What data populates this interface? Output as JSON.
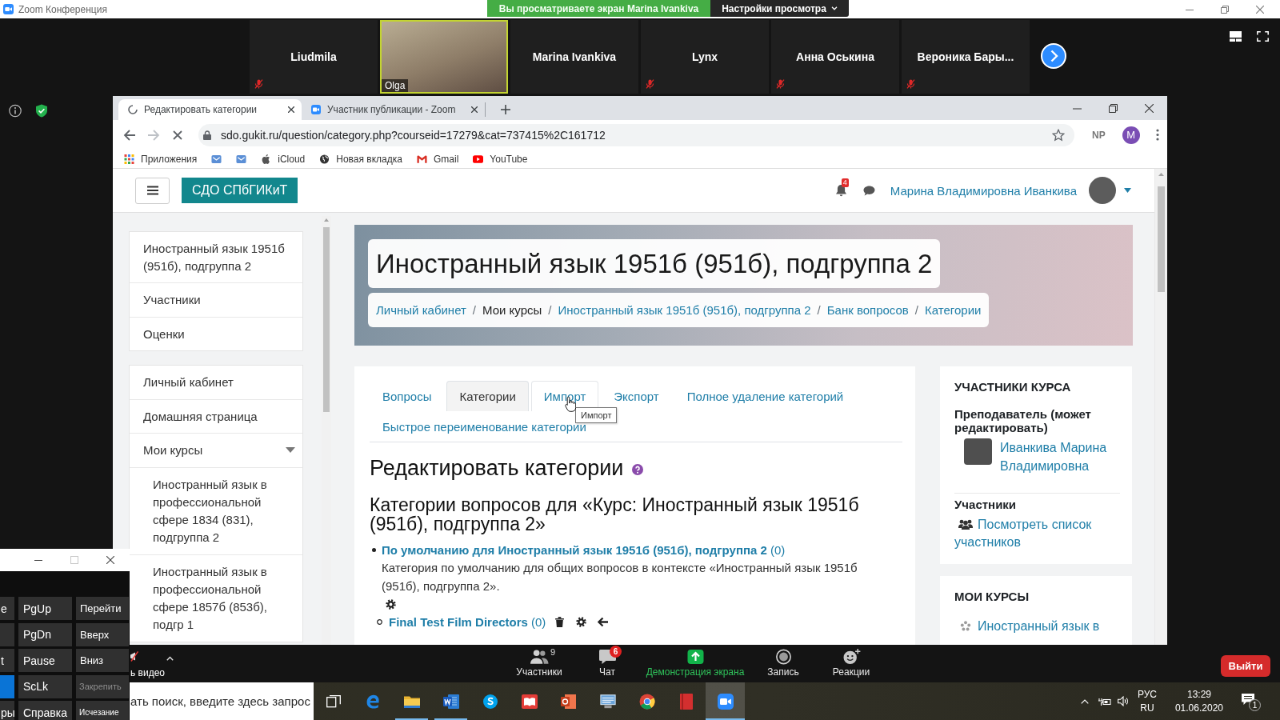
{
  "zoom_window": {
    "title": "Zoom Конференция",
    "share_banner": "Вы просматриваете экран Marina Ivankiva",
    "view_options": "Настройки просмотра"
  },
  "participants": [
    {
      "name": "Liudmila",
      "kind": "name",
      "muted": true,
      "speaking": false
    },
    {
      "name": "Olga",
      "kind": "video",
      "muted": false,
      "speaking": true
    },
    {
      "name": "Marina Ivankiva",
      "kind": "name",
      "muted": false,
      "speaking": false
    },
    {
      "name": "Lynx",
      "kind": "name",
      "muted": true,
      "speaking": false
    },
    {
      "name": "Анна Оськина",
      "kind": "name",
      "muted": true,
      "speaking": false
    },
    {
      "name": "Вероника Бары...",
      "kind": "name",
      "muted": true,
      "speaking": false
    }
  ],
  "browser": {
    "tabs": [
      {
        "title": "Редактировать категории",
        "selected": true,
        "loading": true
      },
      {
        "title": "Участник публикации - Zoom",
        "selected": false,
        "loading": false
      }
    ],
    "url": "sdo.gukit.ru/question/category.php?courseid=17279&cat=737415%2C161712",
    "extension": "NP",
    "profile": "M",
    "bookmarks": [
      {
        "kind": "apps",
        "label": "Приложения"
      },
      {
        "kind": "envelope"
      },
      {
        "kind": "envelope"
      },
      {
        "kind": "apple",
        "label": "iCloud"
      },
      {
        "kind": "globe",
        "label": "Новая вкладка"
      },
      {
        "kind": "mail-logo",
        "label": "Gmail"
      },
      {
        "kind": "play",
        "label": "YouTube"
      }
    ]
  },
  "site": {
    "brand": "СДО СПбГИКиТ",
    "notification_count": "4",
    "user_name": "Марина Владимировна Иванкива"
  },
  "drawer": {
    "groups": [
      {
        "items": [
          {
            "label": "Иностранный язык 1951б (951б), подгруппа 2",
            "kind": "link"
          },
          {
            "label": "Участники",
            "kind": "link"
          },
          {
            "label": "Оценки",
            "kind": "link"
          }
        ]
      },
      {
        "items": [
          {
            "label": "Личный кабинет",
            "kind": "link"
          },
          {
            "label": "Домашняя страница",
            "kind": "link"
          },
          {
            "label": "Мои курсы",
            "kind": "branch",
            "expanded": true,
            "children": [
              {
                "label": "Иностранный язык в профессиональной сфере 1834 (831), подгруппа 2",
                "kind": "link"
              },
              {
                "label": "Иностранный язык в профессиональной сфере 1857б (853б), подгр 1",
                "kind": "link"
              }
            ]
          }
        ]
      }
    ]
  },
  "page_header": {
    "title": "Иностранный язык 1951б (951б), подгруппа 2",
    "breadcrumb": [
      {
        "label": "Личный кабинет",
        "link": true
      },
      {
        "separator": "/",
        "label": "Мои курсы",
        "link": false
      },
      {
        "separator": "/",
        "label": "Иностранный язык 1951б (951б), подгруппа 2",
        "link": true
      },
      {
        "separator": "/",
        "label": "Банк вопросов",
        "link": true
      },
      {
        "separator": "/",
        "label": "Категории",
        "link": true
      }
    ]
  },
  "tabs": [
    {
      "label": "Вопросы",
      "selected": false,
      "hovered": false
    },
    {
      "label": "Категории",
      "selected": true,
      "hovered": false
    },
    {
      "label": "Импорт",
      "selected": false,
      "hovered": true
    },
    {
      "label": "Экспорт",
      "selected": false,
      "hovered": false
    },
    {
      "label": "Полное удаление категорий",
      "selected": false,
      "hovered": false
    },
    {
      "label": "Быстрое переименование категории",
      "selected": false,
      "hovered": false
    }
  ],
  "tooltip": "Импорт",
  "heading": "Редактировать категории",
  "context_heading": "Категории вопросов для «Курс: Иностранный язык 1951б (951б), подгруппа 2»",
  "categories": [
    {
      "name": "По умолчанию для Иностранный язык 1951б (951б), подгруппа 2",
      "count": "(0)",
      "description": "Категория по умолчанию для общих вопросов в контексте «Иностранный язык 1951б (951б), подгруппа 2».",
      "actions": [
        {
          "kind": "settings"
        }
      ],
      "children": [
        {
          "name": "Final Test Film Directors",
          "count": "(0)",
          "actions": [
            {
              "kind": "delete"
            },
            {
              "kind": "settings"
            },
            {
              "kind": "move-left"
            }
          ]
        }
      ]
    }
  ],
  "participants_block": {
    "title": "УЧАСТНИКИ КУРСА",
    "role": "Преподаватель (может редактировать)",
    "teacher": "Иванкива Марина Владимировна",
    "section": "Участники",
    "list_link": "Посмотреть список участников"
  },
  "my_courses_block": {
    "title": "МОИ КУРСЫ",
    "courses": [
      "Иностранный язык в"
    ]
  },
  "meeting_toolbar": {
    "video_label": "ь видео",
    "buttons": [
      {
        "kind": "participants",
        "label": "Участники",
        "count": "9"
      },
      {
        "kind": "chat",
        "label": "Чат",
        "badge": "6"
      },
      {
        "kind": "share",
        "label": "Демонстрация экрана"
      },
      {
        "kind": "record",
        "label": "Запись"
      },
      {
        "kind": "reactions",
        "label": "Реакции"
      }
    ],
    "leave": "Выйти"
  },
  "keyboard": {
    "keys": [
      {
        "label": "e",
        "kind": "key",
        "highlighted": false
      },
      {
        "label": "PgUp",
        "kind": "key",
        "highlighted": false
      },
      {
        "label": "Перейти",
        "kind": "key",
        "highlighted": false
      },
      {
        "kind": "key",
        "highlighted": false
      },
      {
        "label": "PgDn",
        "kind": "key",
        "highlighted": false
      },
      {
        "label": "Вверх",
        "kind": "key",
        "highlighted": false
      },
      {
        "label": "t",
        "kind": "key",
        "highlighted": false
      },
      {
        "label": "Pause",
        "kind": "key",
        "highlighted": false
      },
      {
        "label": "Вниз",
        "kind": "key",
        "highlighted": false
      },
      {
        "kind": "key",
        "highlighted": true
      },
      {
        "label": "ScLk",
        "kind": "key",
        "highlighted": false
      },
      {
        "label": "Закрепить",
        "kind": "dock",
        "highlighted": false
      },
      {
        "label": "ры",
        "kind": "key",
        "highlighted": false
      },
      {
        "label": "Справка",
        "kind": "key",
        "highlighted": false
      },
      {
        "label": "Исчезание",
        "kind": "fade",
        "highlighted": false
      }
    ]
  },
  "taskbar": {
    "search": {
      "placeholder": "ать поиск, введите здесь запрос"
    },
    "apps": [
      {
        "kind": "task-view",
        "active": false,
        "running": false
      },
      {
        "kind": "e-browser",
        "active": false,
        "running": false
      },
      {
        "kind": "folder",
        "active": false,
        "running": true
      },
      {
        "kind": "w-doc",
        "active": false,
        "running": true
      },
      {
        "kind": "s-chat",
        "active": false,
        "running": false
      },
      {
        "kind": "red-book",
        "active": false,
        "running": false
      },
      {
        "kind": "p-slides",
        "active": false,
        "running": false
      },
      {
        "kind": "monitor",
        "active": false,
        "running": false
      },
      {
        "kind": "tri-ring",
        "active": false,
        "running": false
      },
      {
        "kind": "red-note",
        "active": false,
        "running": false
      },
      {
        "kind": "camera",
        "active": true,
        "running": true
      }
    ],
    "language": "РУС",
    "layout": "RU",
    "time": "13:29",
    "date": "01.06.2020",
    "notification_count": "1"
  }
}
